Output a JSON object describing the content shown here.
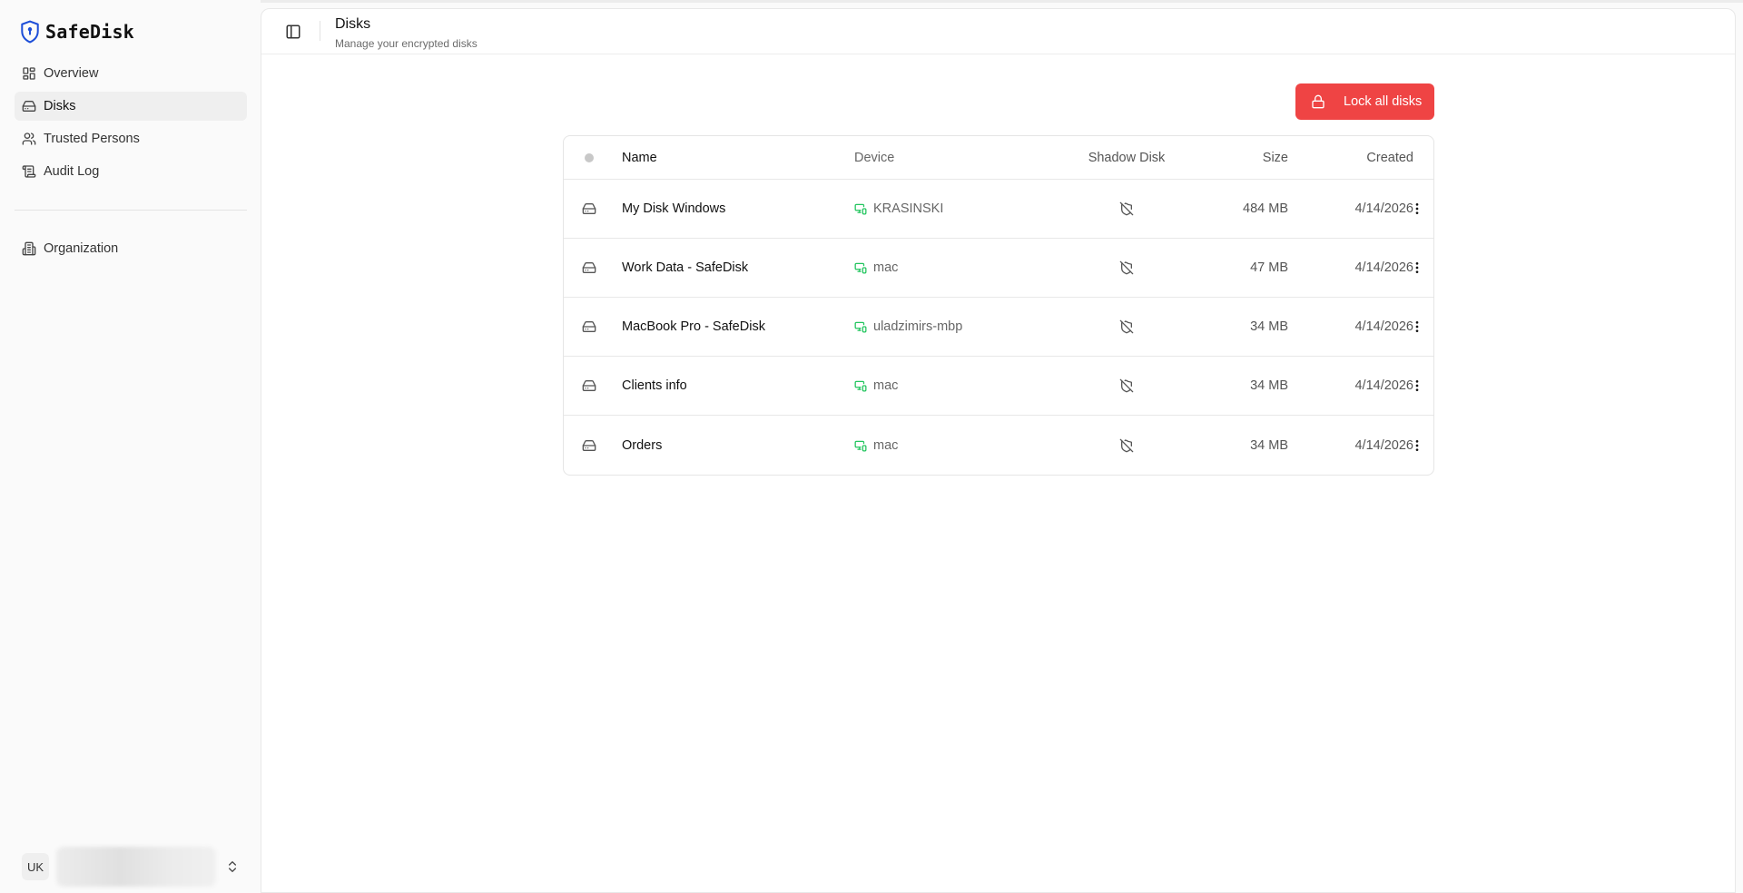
{
  "app": {
    "name": "SafeDisk",
    "accent": "#1d4ed8"
  },
  "sidebar": {
    "items": [
      {
        "label": "Overview",
        "icon": "dashboard-icon"
      },
      {
        "label": "Disks",
        "icon": "hard-drive-icon",
        "active": true
      },
      {
        "label": "Trusted Persons",
        "icon": "users-icon"
      },
      {
        "label": "Audit Log",
        "icon": "scroll-icon"
      }
    ],
    "secondary": [
      {
        "label": "Organization",
        "icon": "building-icon"
      }
    ],
    "user": {
      "initials": "UK"
    }
  },
  "header": {
    "title": "Disks",
    "subtitle": "Manage your encrypted disks"
  },
  "actions": {
    "lock_all_label": "Lock all disks",
    "lock_all_color": "#ef4444"
  },
  "table": {
    "columns": {
      "name": "Name",
      "device": "Device",
      "shadow": "Shadow Disk",
      "size": "Size",
      "created": "Created"
    },
    "rows": [
      {
        "name": "My Disk Windows",
        "device": "KRASINSKI",
        "size": "484 MB",
        "created": "4/14/2026"
      },
      {
        "name": "Work Data - SafeDisk",
        "device": "mac",
        "size": "47 MB",
        "created": "4/14/2026"
      },
      {
        "name": "MacBook Pro - SafeDisk",
        "device": "uladzimirs-mbp",
        "size": "34 MB",
        "created": "4/14/2026"
      },
      {
        "name": "Clients info",
        "device": "mac",
        "size": "34 MB",
        "created": "4/14/2026"
      },
      {
        "name": "Orders",
        "device": "mac",
        "size": "34 MB",
        "created": "4/14/2026"
      }
    ],
    "device_status_color": "#22c55e"
  }
}
